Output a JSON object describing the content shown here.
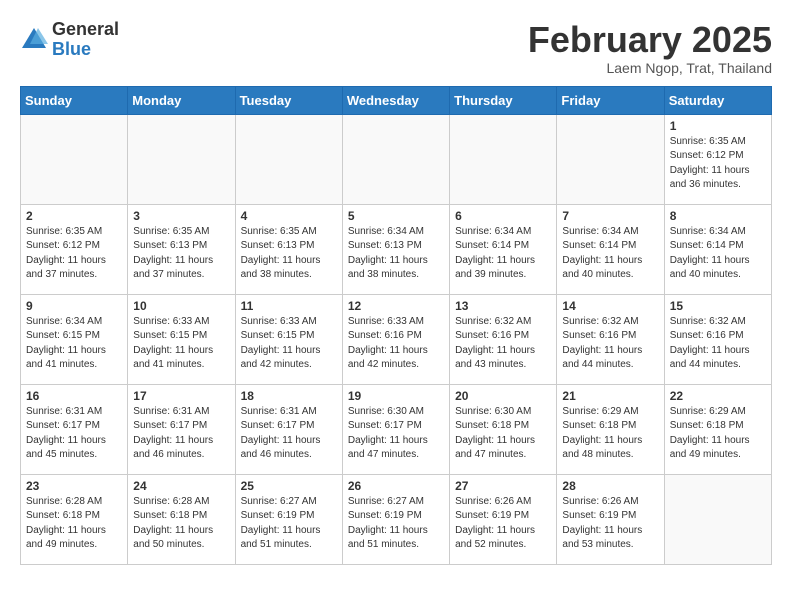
{
  "header": {
    "logo_general": "General",
    "logo_blue": "Blue",
    "month_title": "February 2025",
    "location": "Laem Ngop, Trat, Thailand"
  },
  "weekdays": [
    "Sunday",
    "Monday",
    "Tuesday",
    "Wednesday",
    "Thursday",
    "Friday",
    "Saturday"
  ],
  "weeks": [
    [
      {
        "day": "",
        "info": ""
      },
      {
        "day": "",
        "info": ""
      },
      {
        "day": "",
        "info": ""
      },
      {
        "day": "",
        "info": ""
      },
      {
        "day": "",
        "info": ""
      },
      {
        "day": "",
        "info": ""
      },
      {
        "day": "1",
        "info": "Sunrise: 6:35 AM\nSunset: 6:12 PM\nDaylight: 11 hours\nand 36 minutes."
      }
    ],
    [
      {
        "day": "2",
        "info": "Sunrise: 6:35 AM\nSunset: 6:12 PM\nDaylight: 11 hours\nand 37 minutes."
      },
      {
        "day": "3",
        "info": "Sunrise: 6:35 AM\nSunset: 6:13 PM\nDaylight: 11 hours\nand 37 minutes."
      },
      {
        "day": "4",
        "info": "Sunrise: 6:35 AM\nSunset: 6:13 PM\nDaylight: 11 hours\nand 38 minutes."
      },
      {
        "day": "5",
        "info": "Sunrise: 6:34 AM\nSunset: 6:13 PM\nDaylight: 11 hours\nand 38 minutes."
      },
      {
        "day": "6",
        "info": "Sunrise: 6:34 AM\nSunset: 6:14 PM\nDaylight: 11 hours\nand 39 minutes."
      },
      {
        "day": "7",
        "info": "Sunrise: 6:34 AM\nSunset: 6:14 PM\nDaylight: 11 hours\nand 40 minutes."
      },
      {
        "day": "8",
        "info": "Sunrise: 6:34 AM\nSunset: 6:14 PM\nDaylight: 11 hours\nand 40 minutes."
      }
    ],
    [
      {
        "day": "9",
        "info": "Sunrise: 6:34 AM\nSunset: 6:15 PM\nDaylight: 11 hours\nand 41 minutes."
      },
      {
        "day": "10",
        "info": "Sunrise: 6:33 AM\nSunset: 6:15 PM\nDaylight: 11 hours\nand 41 minutes."
      },
      {
        "day": "11",
        "info": "Sunrise: 6:33 AM\nSunset: 6:15 PM\nDaylight: 11 hours\nand 42 minutes."
      },
      {
        "day": "12",
        "info": "Sunrise: 6:33 AM\nSunset: 6:16 PM\nDaylight: 11 hours\nand 42 minutes."
      },
      {
        "day": "13",
        "info": "Sunrise: 6:32 AM\nSunset: 6:16 PM\nDaylight: 11 hours\nand 43 minutes."
      },
      {
        "day": "14",
        "info": "Sunrise: 6:32 AM\nSunset: 6:16 PM\nDaylight: 11 hours\nand 44 minutes."
      },
      {
        "day": "15",
        "info": "Sunrise: 6:32 AM\nSunset: 6:16 PM\nDaylight: 11 hours\nand 44 minutes."
      }
    ],
    [
      {
        "day": "16",
        "info": "Sunrise: 6:31 AM\nSunset: 6:17 PM\nDaylight: 11 hours\nand 45 minutes."
      },
      {
        "day": "17",
        "info": "Sunrise: 6:31 AM\nSunset: 6:17 PM\nDaylight: 11 hours\nand 46 minutes."
      },
      {
        "day": "18",
        "info": "Sunrise: 6:31 AM\nSunset: 6:17 PM\nDaylight: 11 hours\nand 46 minutes."
      },
      {
        "day": "19",
        "info": "Sunrise: 6:30 AM\nSunset: 6:17 PM\nDaylight: 11 hours\nand 47 minutes."
      },
      {
        "day": "20",
        "info": "Sunrise: 6:30 AM\nSunset: 6:18 PM\nDaylight: 11 hours\nand 47 minutes."
      },
      {
        "day": "21",
        "info": "Sunrise: 6:29 AM\nSunset: 6:18 PM\nDaylight: 11 hours\nand 48 minutes."
      },
      {
        "day": "22",
        "info": "Sunrise: 6:29 AM\nSunset: 6:18 PM\nDaylight: 11 hours\nand 49 minutes."
      }
    ],
    [
      {
        "day": "23",
        "info": "Sunrise: 6:28 AM\nSunset: 6:18 PM\nDaylight: 11 hours\nand 49 minutes."
      },
      {
        "day": "24",
        "info": "Sunrise: 6:28 AM\nSunset: 6:18 PM\nDaylight: 11 hours\nand 50 minutes."
      },
      {
        "day": "25",
        "info": "Sunrise: 6:27 AM\nSunset: 6:19 PM\nDaylight: 11 hours\nand 51 minutes."
      },
      {
        "day": "26",
        "info": "Sunrise: 6:27 AM\nSunset: 6:19 PM\nDaylight: 11 hours\nand 51 minutes."
      },
      {
        "day": "27",
        "info": "Sunrise: 6:26 AM\nSunset: 6:19 PM\nDaylight: 11 hours\nand 52 minutes."
      },
      {
        "day": "28",
        "info": "Sunrise: 6:26 AM\nSunset: 6:19 PM\nDaylight: 11 hours\nand 53 minutes."
      },
      {
        "day": "",
        "info": ""
      }
    ]
  ]
}
